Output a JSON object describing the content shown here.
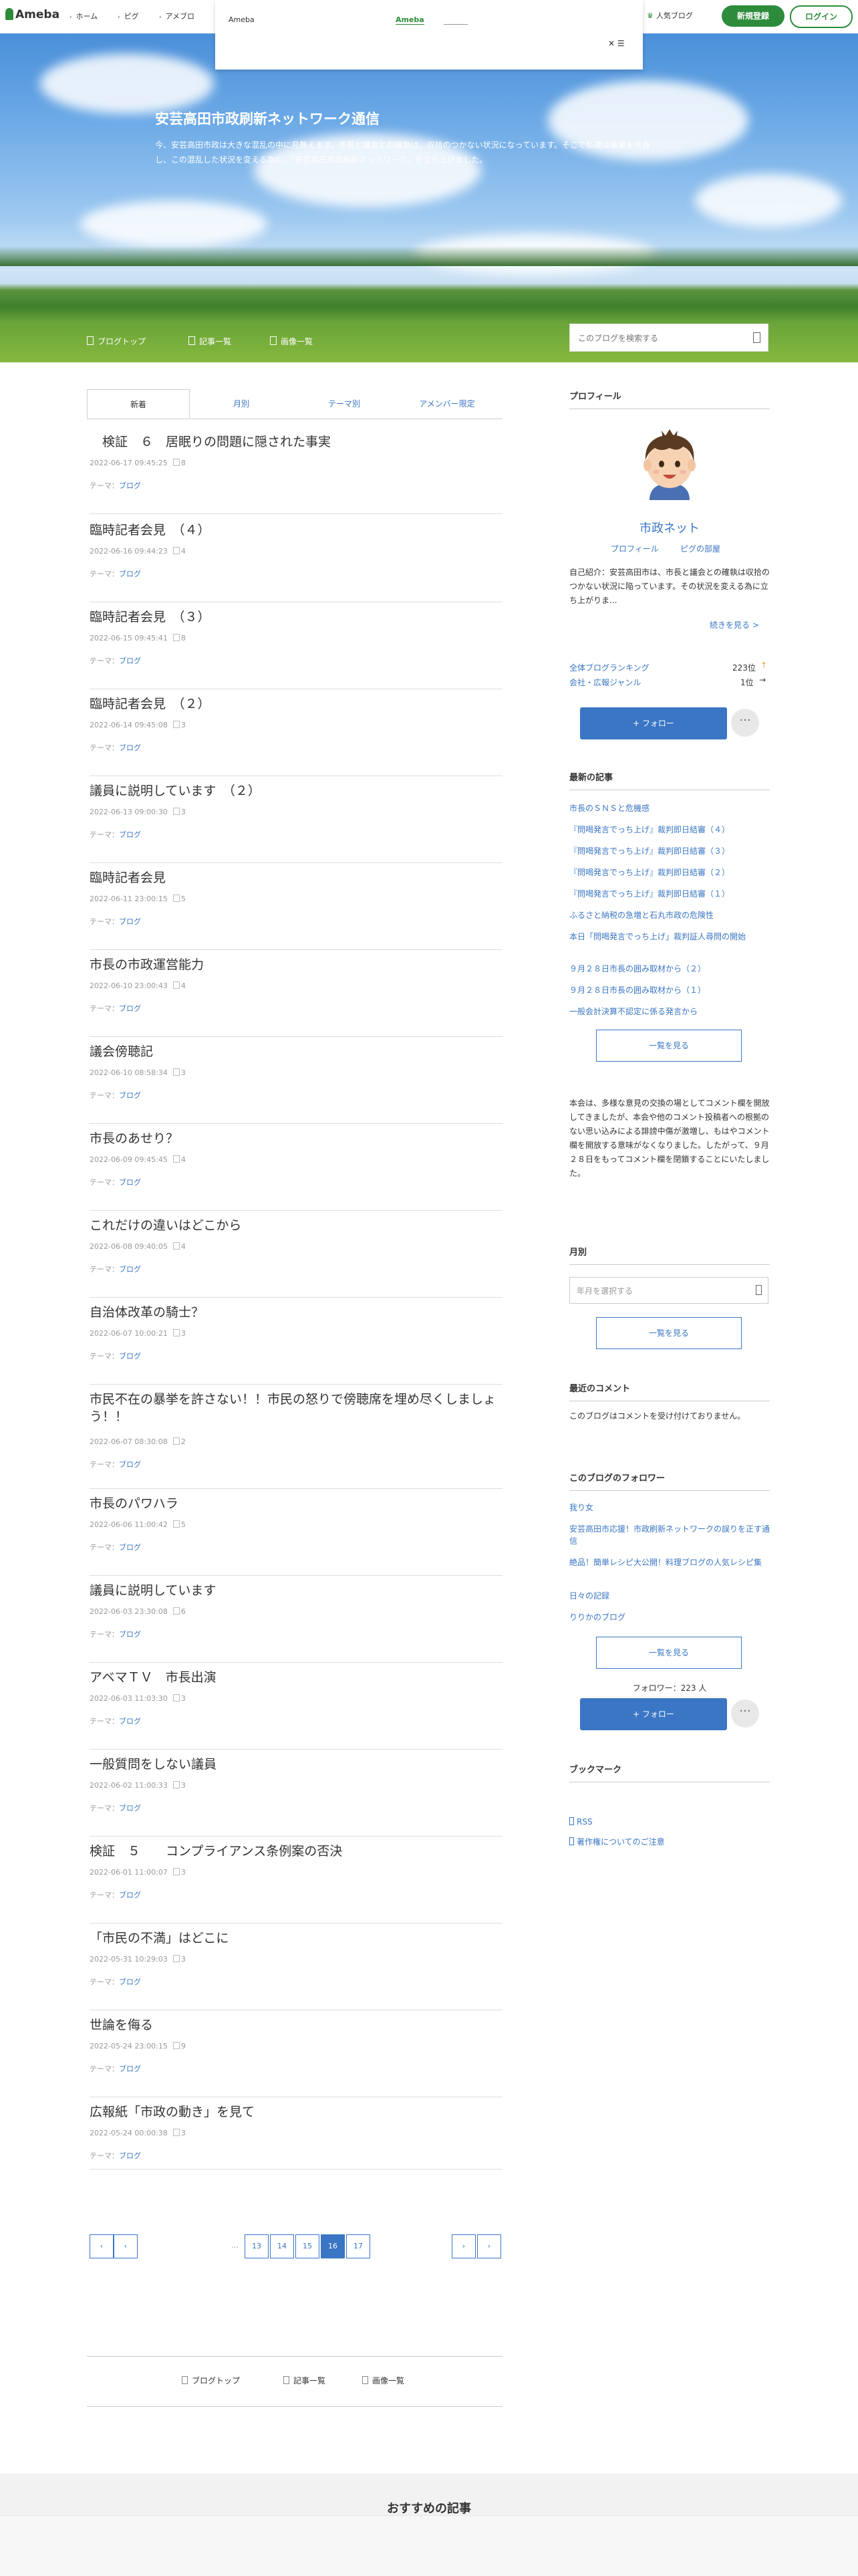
{
  "topbar": {
    "logo": "Ameba",
    "nav": [
      "ホーム",
      "ピグ",
      "アメブロ"
    ],
    "popular": "人気ブログ",
    "signup": "新規登録",
    "login": "ログイン"
  },
  "ad": {
    "label": "Ameba",
    "link": "Ameba",
    "close": "✕ ☰"
  },
  "hero": {
    "title": "安芸高田市政刷新ネットワーク通信",
    "description": "今、安芸高田市政は大きな混乱の中に見舞えます。市長と議会との確執は、収拾のつかない状況になっています。そこで私達は事業を共有し、この混乱した状況を変える為に、「安芸高田市政刷新ネットワーク」を立ち上げました。"
  },
  "blognav": {
    "top": "ブログトップ",
    "list": "記事一覧",
    "images": "画像一覧",
    "search_placeholder": "このブログを検索する"
  },
  "tabs": [
    "新着",
    "月別",
    "テーマ別",
    "アメンバー限定"
  ],
  "entries": [
    {
      "title": "　検証　６　居眠りの問題に隠された事実",
      "date": "2022-06-17 09:45:25",
      "comments": "8",
      "theme_label": "テーマ：",
      "theme": "ブログ"
    },
    {
      "title": "臨時記者会見　（４）",
      "date": "2022-06-16 09:44:23",
      "comments": "4",
      "theme_label": "テーマ：",
      "theme": "ブログ"
    },
    {
      "title": "臨時記者会見　（３）",
      "date": "2022-06-15 09:45:41",
      "comments": "8",
      "theme_label": "テーマ：",
      "theme": "ブログ"
    },
    {
      "title": "臨時記者会見　（２）",
      "date": "2022-06-14 09:45:08",
      "comments": "3",
      "theme_label": "テーマ：",
      "theme": "ブログ"
    },
    {
      "title": "議員に説明しています　（２）",
      "date": "2022-06-13 09:00:30",
      "comments": "3",
      "theme_label": "テーマ：",
      "theme": "ブログ"
    },
    {
      "title": "臨時記者会見",
      "date": "2022-06-11 23:00:15",
      "comments": "5",
      "theme_label": "テーマ：",
      "theme": "ブログ"
    },
    {
      "title": "市長の市政運営能力",
      "date": "2022-06-10 23:00:43",
      "comments": "4",
      "theme_label": "テーマ：",
      "theme": "ブログ"
    },
    {
      "title": "議会傍聴記",
      "date": "2022-06-10 08:58:34",
      "comments": "3",
      "theme_label": "テーマ：",
      "theme": "ブログ"
    },
    {
      "title": "市長のあせり？",
      "date": "2022-06-09 09:45:45",
      "comments": "4",
      "theme_label": "テーマ：",
      "theme": "ブログ"
    },
    {
      "title": "これだけの違いはどこから",
      "date": "2022-06-08 09:40:05",
      "comments": "4",
      "theme_label": "テーマ：",
      "theme": "ブログ"
    },
    {
      "title": "自治体改革の騎士？",
      "date": "2022-06-07 10:00:21",
      "comments": "3",
      "theme_label": "テーマ：",
      "theme": "ブログ"
    },
    {
      "title": "市民不在の暴挙を許さない！！市民の怒りで傍聴席を埋め尽くしましょう！！",
      "date": "2022-06-07 08:30:08",
      "comments": "2",
      "theme_label": "テーマ：",
      "theme": "ブログ"
    },
    {
      "title": "市長のパワハラ",
      "date": "2022-06-06 11:00:42",
      "comments": "5",
      "theme_label": "テーマ：",
      "theme": "ブログ"
    },
    {
      "title": "議員に説明しています",
      "date": "2022-06-03 23:30:08",
      "comments": "6",
      "theme_label": "テーマ：",
      "theme": "ブログ"
    },
    {
      "title": "アベマＴＶ　市長出演",
      "date": "2022-06-03 11:03:30",
      "comments": "3",
      "theme_label": "テーマ：",
      "theme": "ブログ"
    },
    {
      "title": "一般質問をしない議員",
      "date": "2022-06-02 11:00:33",
      "comments": "3",
      "theme_label": "テーマ：",
      "theme": "ブログ"
    },
    {
      "title": "検証　５　　コンプライアンス条例案の否決",
      "date": "2022-06-01 11:00:07",
      "comments": "3",
      "theme_label": "テーマ：",
      "theme": "ブログ"
    },
    {
      "title": "「市民の不満」はどこに",
      "date": "2022-05-31 10:29:03",
      "comments": "3",
      "theme_label": "テーマ：",
      "theme": "ブログ"
    },
    {
      "title": "世論を侮る",
      "date": "2022-05-24 23:00:15",
      "comments": "9",
      "theme_label": "テーマ：",
      "theme": "ブログ"
    },
    {
      "title": "広報紙「市政の動き」を見て",
      "date": "2022-05-24 00:00:38",
      "comments": "3",
      "theme_label": "テーマ：",
      "theme": "ブログ"
    }
  ],
  "pagination": {
    "first": "‹",
    "prev": "‹",
    "ellipsis": "…",
    "pages": [
      "13",
      "14",
      "15",
      "16",
      "17"
    ],
    "current": "16",
    "next": "›",
    "last": "›"
  },
  "footnav": {
    "top": "ブログトップ",
    "list": "記事一覧",
    "images": "画像一覧"
  },
  "recommend": "おすすめの記事",
  "sidebar": {
    "profile_head": "プロフィール",
    "name": "市政ネット",
    "profile_link": "プロフィール",
    "pig_link": "ピグの部屋",
    "intro": "自己紹介：安芸高田市は、市長と議会との確執は収拾のつかない状況に陥っています。その状況を変える為に立ち上がりま...",
    "more": "続きを見る >",
    "rank_all_label": "全体ブログランキング",
    "rank_all_value": "223位",
    "rank_genre_label": "会社・広報ジャンル",
    "rank_genre_value": "1位",
    "follow": "+ フォロー",
    "more_btn": "···",
    "recent_head": "最新の記事",
    "recent": [
      "市長のＳＮＳと危機感",
      "『問喝発言でっち上げ』裁判即日結審（４）",
      "『問喝発言でっち上げ』裁判即日結審（３）",
      "『問喝発言でっち上げ』裁判即日結審（２）",
      "『問喝発言でっち上げ』裁判即日結審（１）",
      "ふるさと納税の急増と石丸市政の危険性",
      "本日「問喝発言でっち上げ」裁判証人尋問の開始",
      "９月２８日市長の囲み取材から（２）",
      "９月２８日市長の囲み取材から（１）",
      "一般会計決算不認定に係る発言から"
    ],
    "recent_btn": "一覧を見る",
    "notice": "本会は、多様な意見の交換の場としてコメント欄を開放してきましたが、本会や他のコメント投稿者への根拠のない思い込みによる誹謗中傷が激増し、もはやコメント欄を開放する意味がなくなりました。したがって、９月２８日をもってコメント欄を閉鎖することにいたしました。",
    "monthly_head": "月別",
    "monthly_placeholder": "年月を選択する",
    "monthly_btn": "一覧を見る",
    "comments_head": "最近のコメント",
    "comments_text": "このブログはコメントを受け付けておりません。",
    "followers_head": "このブログのフォロワー",
    "followers": [
      "我り女",
      "安芸高田市応援！市政刷新ネットワークの誤りを正す通信",
      "絶品！簡単レシピ大公開！料理ブログの人気レシピ集",
      "日々の記録",
      "りりかのブログ"
    ],
    "followers_btn": "一覧を見る",
    "followers_count": "フォロワー：223 人",
    "bookmark_head": "ブックマーク",
    "rss": "RSS",
    "copyright": "著作権についてのご注意"
  },
  "colors": {
    "accent": "#3a76c4",
    "brand": "#2d8c3c"
  }
}
